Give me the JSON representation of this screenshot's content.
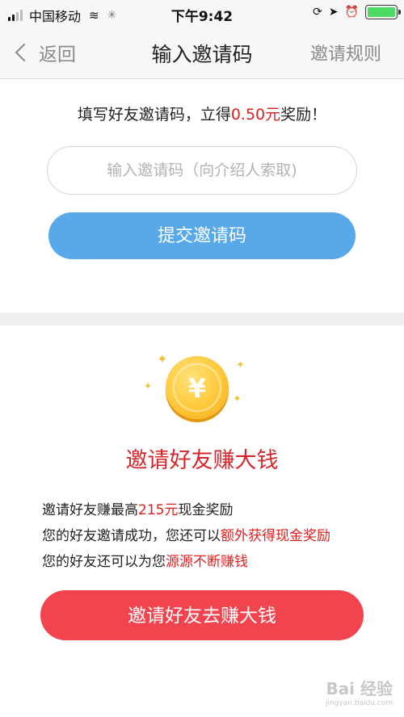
{
  "status_bar": {
    "carrier": "中国移动",
    "time": "下午9:42",
    "battery_color": "#4cd964"
  },
  "nav": {
    "back_label": "返回",
    "title": "输入邀请码",
    "rules_label": "邀请规则"
  },
  "invite_code": {
    "prompt_prefix": "填写好友邀请码，立得",
    "prompt_amount": "0.50元",
    "prompt_suffix": "奖励！",
    "input_placeholder": "输入邀请码（向介绍人索取)",
    "submit_label": "提交邀请码",
    "submit_color": "#57a9ea"
  },
  "promo": {
    "coin_symbol": "¥",
    "headline": "邀请好友赚大钱",
    "lines": [
      {
        "before": "邀请好友赚最高",
        "highlight": "215元",
        "after": "现金奖励"
      },
      {
        "before": "您的好友邀请成功，您还可以",
        "highlight": "额外获得现金奖励",
        "after": ""
      },
      {
        "before": "您的好友还可以为您",
        "highlight": "源源不断赚钱",
        "after": ""
      }
    ],
    "cta_label": "邀请好友去赚大钱",
    "cta_color": "#f2444f",
    "highlight_color": "#e02020"
  },
  "watermark": {
    "main": "Bai 经验",
    "sub": "jingyan.baidu.com"
  }
}
